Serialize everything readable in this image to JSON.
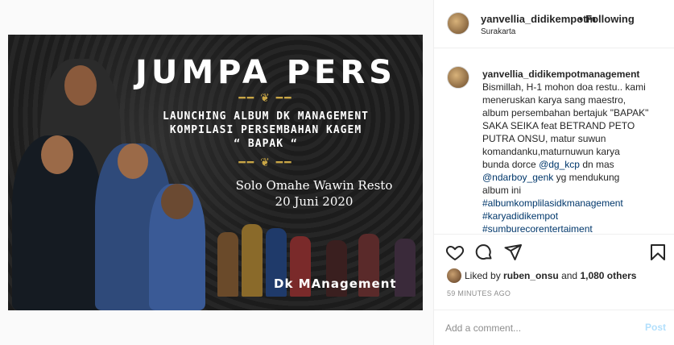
{
  "post_image": {
    "headline": "JUMPA PERS",
    "line1": "LAUNCHING ALBUM DK MANAGEMENT",
    "line2": "KOMPILASI PERSEMBAHAN KAGEM",
    "line3": "“ BAPAK “",
    "venue": "Solo Omahe Wawin Resto",
    "date": "20 Juni 2020",
    "footer": "Dk MAnagement"
  },
  "header": {
    "username": "yanvellia_didikempotm",
    "follow_label": "• Following",
    "location": "Surakarta"
  },
  "caption": {
    "username": "yanvellia_didikempotmanagement",
    "lines": [
      "Bismillah, H-1 mohon doa restu.. kami",
      "meneruskan karya sang maestro,",
      "album persembahan bertajuk \"BAPAK\"",
      "SAKA SEIKA feat BETRAND PETO",
      "PUTRA ONSU, matur suwun",
      "komandanku,maturnuwun karya",
      "bunda dorce",
      "@dg_kcp",
      "dn mas",
      "@ndarboy_genk",
      "yg mendukung",
      "album ini",
      "#albumkomplilasidkmanagement",
      "#karyadidikempot",
      "#sumburecorentertaiment"
    ]
  },
  "actions": {
    "icons": [
      "heart-icon",
      "comment-icon",
      "share-icon",
      "bookmark-icon"
    ]
  },
  "likes": {
    "prefix": "Liked by",
    "user": "ruben_onsu",
    "middle": "and",
    "count": "1,080 others"
  },
  "time": "59 MINUTES AGO",
  "comment": {
    "placeholder": "Add a comment...",
    "post_label": "Post"
  },
  "colors": {
    "link": "#00376b",
    "muted": "#8e8e8e",
    "post_disabled": "#b2dffc",
    "gold": "#c9a646"
  }
}
